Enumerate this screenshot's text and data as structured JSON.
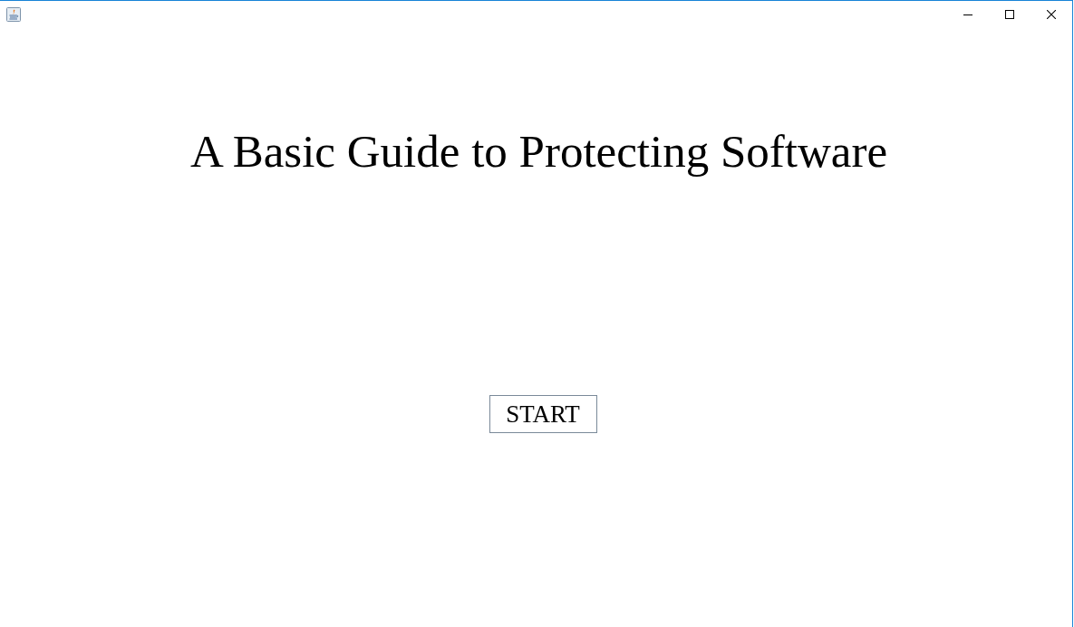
{
  "heading": "A Basic Guide to Protecting Software",
  "start_button": {
    "label": "START"
  }
}
